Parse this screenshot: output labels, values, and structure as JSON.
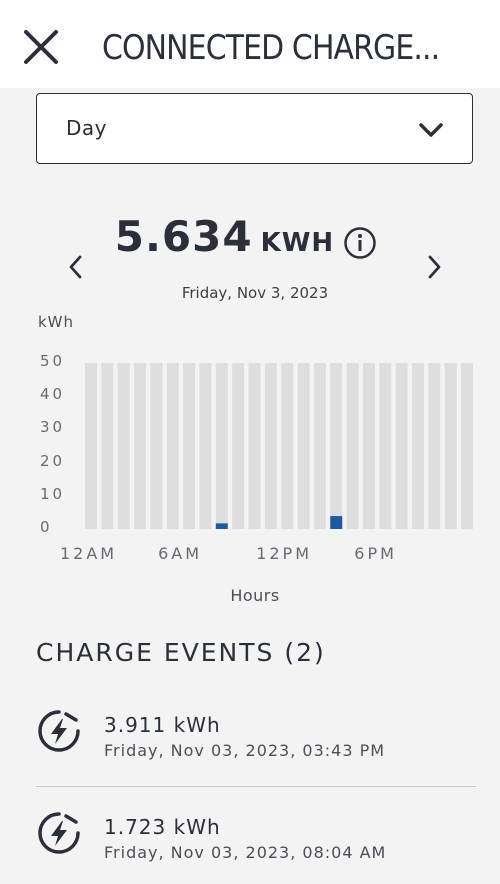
{
  "header": {
    "title": "CONNECTED CHARGE..."
  },
  "period_selector": {
    "value": "Day"
  },
  "summary": {
    "total_value": "5.634",
    "total_unit": "KWH",
    "date": "Friday, Nov 3, 2023"
  },
  "chart_labels": {
    "y_unit": "kWh",
    "x_title": "Hours"
  },
  "chart_data": {
    "type": "bar",
    "categories": [
      "0",
      "1",
      "2",
      "3",
      "4",
      "5",
      "6",
      "7",
      "8",
      "9",
      "10",
      "11",
      "12",
      "13",
      "14",
      "15",
      "16",
      "17",
      "18",
      "19",
      "20",
      "21",
      "22",
      "23"
    ],
    "values": [
      0,
      0,
      0,
      0,
      0,
      0,
      0,
      0,
      1.7,
      0,
      0,
      0,
      0,
      0,
      0,
      3.9,
      0,
      0,
      0,
      0,
      0,
      0,
      0,
      0
    ],
    "ylim": [
      0,
      50
    ],
    "y_ticks": [
      "50",
      "40",
      "30",
      "20",
      "10",
      "0"
    ],
    "x_ticks": [
      {
        "hour": 0,
        "label": "12AM"
      },
      {
        "hour": 6,
        "label": "6AM"
      },
      {
        "hour": 12,
        "label": "12PM"
      },
      {
        "hour": 18,
        "label": "6PM"
      }
    ],
    "colors": {
      "bar_background": "#dedede",
      "bar_value": "#1f5a9e"
    }
  },
  "events": {
    "title": "CHARGE EVENTS (2)",
    "items": [
      {
        "energy": "3.911 kWh",
        "time": "Friday, Nov 03, 2023, 03:43 PM",
        "icon": "charge-bolt-icon"
      },
      {
        "energy": "1.723 kWh",
        "time": "Friday, Nov 03, 2023, 08:04 AM",
        "icon": "charge-bolt-icon"
      }
    ]
  }
}
